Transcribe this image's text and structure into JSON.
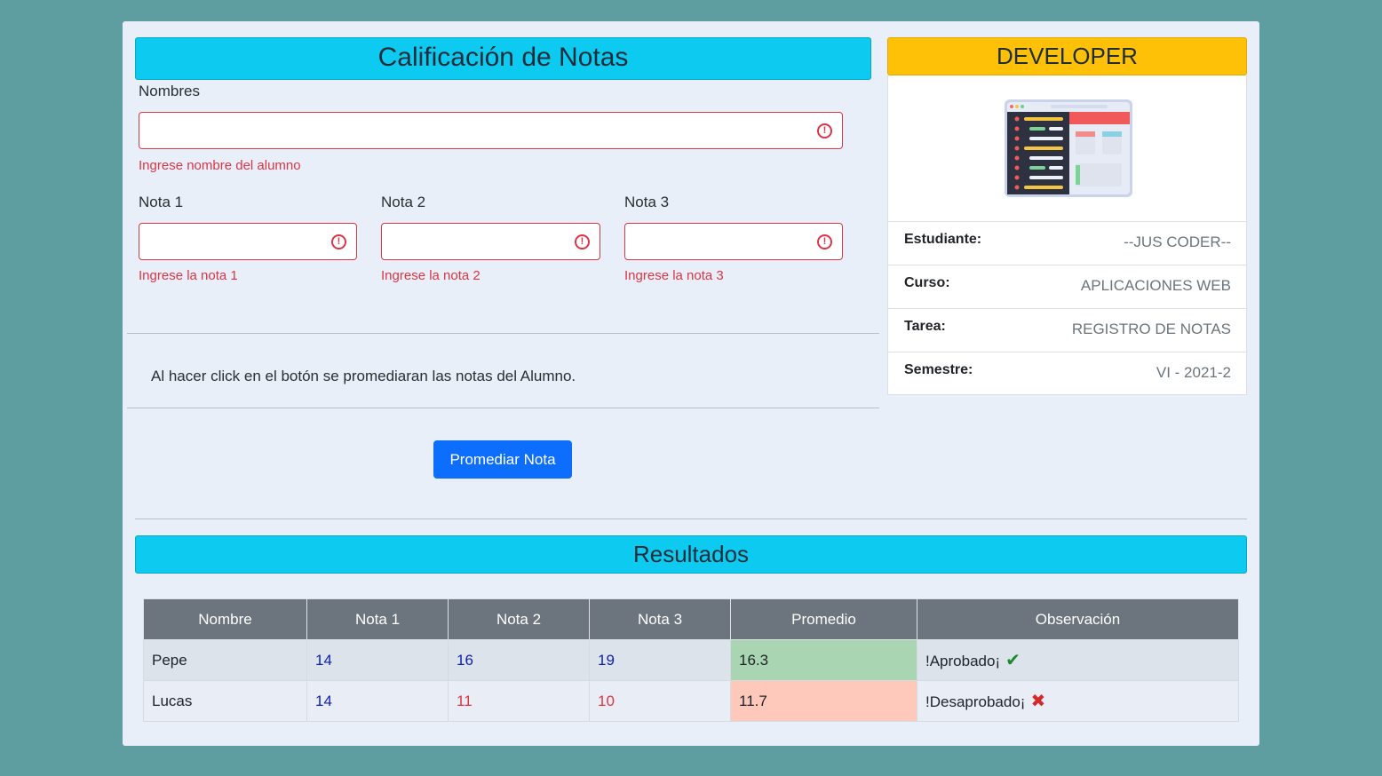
{
  "form": {
    "title": "Calificación de Notas",
    "nombres_label": "Nombres",
    "nombres_value": "",
    "nombres_error": "Ingrese nombre del alumno",
    "notas": [
      {
        "label": "Nota 1",
        "value": "",
        "error": "Ingrese la nota 1"
      },
      {
        "label": "Nota 2",
        "value": "",
        "error": "Ingrese la nota 2"
      },
      {
        "label": "Nota 3",
        "value": "",
        "error": "Ingrese la nota 3"
      }
    ],
    "info_text": "Al hacer click en el botón se promediaran las notas del Alumno.",
    "button_label": "Promediar Nota"
  },
  "developer": {
    "title": "DEVELOPER",
    "image_icon": "web-app-illustration",
    "rows": [
      {
        "key": "Estudiante:",
        "value": "--JUS CODER--"
      },
      {
        "key": "Curso:",
        "value": "APLICACIONES WEB"
      },
      {
        "key": "Tarea:",
        "value": "REGISTRO DE NOTAS"
      },
      {
        "key": "Semestre:",
        "value": "VI - 2021-2"
      }
    ]
  },
  "results": {
    "title": "Resultados",
    "columns": [
      "Nombre",
      "Nota 1",
      "Nota 2",
      "Nota 3",
      "Promedio",
      "Observación"
    ],
    "rows": [
      {
        "nombre": "Pepe",
        "n1": "14",
        "n2": "16",
        "n3": "19",
        "promedio": "16.3",
        "observacion": "!Aprobado¡",
        "icon": "check-icon"
      },
      {
        "nombre": "Lucas",
        "n1": "14",
        "n2": "11",
        "n3": "10",
        "promedio": "11.7",
        "observacion": "!Desaprobado¡",
        "icon": "cross-icon"
      }
    ]
  },
  "colors": {
    "background": "#5f9ea0",
    "info_header": "#0dcaf0",
    "developer_header": "#ffc107",
    "primary_button": "#0d6efd",
    "error": "#dc3545",
    "pass": "#a9d5b2",
    "fail": "#fec8bb"
  }
}
